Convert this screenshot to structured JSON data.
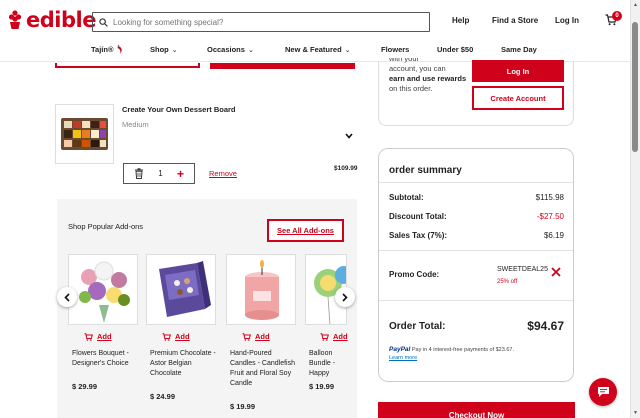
{
  "brand": {
    "name": "edible",
    "color": "#d0021b"
  },
  "search": {
    "placeholder": "Looking for something special?"
  },
  "header_links": [
    "Help",
    "Find a Store",
    "Log In"
  ],
  "cart_count": "0",
  "categories": [
    {
      "label": "Tajín®",
      "icon": "chili-pepper-icon"
    },
    {
      "label": "Shop",
      "chevron": true
    },
    {
      "label": "Occasions",
      "chevron": true
    },
    {
      "label": "New & Featured",
      "chevron": true
    },
    {
      "label": "Flowers"
    },
    {
      "label": "Under $50"
    },
    {
      "label": "Same Day"
    }
  ],
  "account_prompt": {
    "line1": "with your",
    "line2": "account, you can",
    "bold": "earn and use rewards",
    "line3": "on this order.",
    "login_label": "Log In",
    "create_label": "Create Account"
  },
  "cart_item": {
    "title": "Create Your Own Dessert Board",
    "size": "Medium",
    "quantity": "1",
    "remove_label": "Remove",
    "price": "$109.99"
  },
  "addons": {
    "title": "Shop Popular Add-ons",
    "see_all_label": "See All Add-ons",
    "add_label": "Add",
    "items": [
      {
        "name": "Flowers Bouquet - Designer's Choice",
        "price": "$ 29.99"
      },
      {
        "name": "Premium Chocolate - Astor Belgian Chocolate",
        "price": "$ 24.99"
      },
      {
        "name": "Hand-Poured Candles - Candlefish Fruit and Floral Soy Candle",
        "price": "$ 19.99"
      },
      {
        "name": "Balloon Bundle - Happy Birthday Bundle",
        "price": "$ 19.99"
      }
    ]
  },
  "summary": {
    "title": "order summary",
    "subtotal_label": "Subtotal:",
    "subtotal": "$115.98",
    "discount_label": "Discount Total:",
    "discount": "-$27.50",
    "tax_label": "Sales Tax (7%):",
    "tax": "$6.19",
    "promo_label": "Promo Code:",
    "promo_code": "SWEETDEAL25",
    "promo_off": "25% off",
    "total_label": "Order Total:",
    "total": "$94.67",
    "paypal_brand": "PayPal",
    "paypal_text": "Pay in 4 interest-free payments of $23.67.",
    "learn_more": "Learn more"
  },
  "checkout_label": "Checkout Now"
}
